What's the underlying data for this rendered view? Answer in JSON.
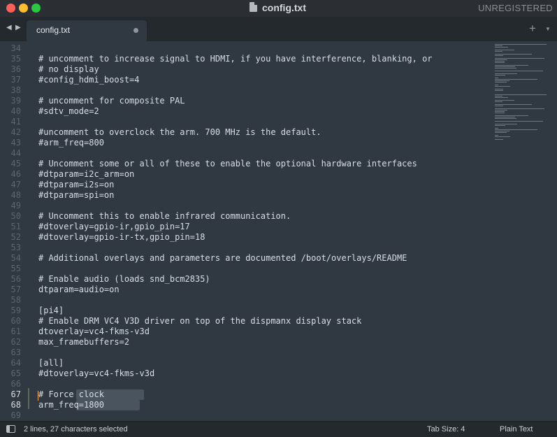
{
  "window": {
    "title": "config.txt",
    "license": "UNREGISTERED"
  },
  "tab": {
    "label": "config.txt"
  },
  "editor": {
    "lines": [
      {
        "n": "34",
        "text": ""
      },
      {
        "n": "35",
        "text": "# uncomment to increase signal to HDMI, if you have interference, blanking, or"
      },
      {
        "n": "36",
        "text": "# no display"
      },
      {
        "n": "37",
        "text": "#config_hdmi_boost=4"
      },
      {
        "n": "38",
        "text": ""
      },
      {
        "n": "39",
        "text": "# uncomment for composite PAL"
      },
      {
        "n": "40",
        "text": "#sdtv_mode=2"
      },
      {
        "n": "41",
        "text": ""
      },
      {
        "n": "42",
        "text": "#uncomment to overclock the arm. 700 MHz is the default."
      },
      {
        "n": "43",
        "text": "#arm_freq=800"
      },
      {
        "n": "44",
        "text": ""
      },
      {
        "n": "45",
        "text": "# Uncomment some or all of these to enable the optional hardware interfaces"
      },
      {
        "n": "46",
        "text": "#dtparam=i2c_arm=on"
      },
      {
        "n": "47",
        "text": "#dtparam=i2s=on"
      },
      {
        "n": "48",
        "text": "#dtparam=spi=on"
      },
      {
        "n": "49",
        "text": ""
      },
      {
        "n": "50",
        "text": "# Uncomment this to enable infrared communication."
      },
      {
        "n": "51",
        "text": "#dtoverlay=gpio-ir,gpio_pin=17"
      },
      {
        "n": "52",
        "text": "#dtoverlay=gpio-ir-tx,gpio_pin=18"
      },
      {
        "n": "53",
        "text": ""
      },
      {
        "n": "54",
        "text": "# Additional overlays and parameters are documented /boot/overlays/README"
      },
      {
        "n": "55",
        "text": ""
      },
      {
        "n": "56",
        "text": "# Enable audio (loads snd_bcm2835)"
      },
      {
        "n": "57",
        "text": "dtparam=audio=on"
      },
      {
        "n": "58",
        "text": ""
      },
      {
        "n": "59",
        "text": "[pi4]"
      },
      {
        "n": "60",
        "text": "# Enable DRM VC4 V3D driver on top of the dispmanx display stack"
      },
      {
        "n": "61",
        "text": "dtoverlay=vc4-fkms-v3d"
      },
      {
        "n": "62",
        "text": "max_framebuffers=2"
      },
      {
        "n": "63",
        "text": ""
      },
      {
        "n": "64",
        "text": "[all]"
      },
      {
        "n": "65",
        "text": "#dtoverlay=vc4-fkms-v3d"
      },
      {
        "n": "66",
        "text": ""
      },
      {
        "n": "67",
        "text": "# Force clock"
      },
      {
        "n": "68",
        "text": "arm_freq=1800"
      },
      {
        "n": "69",
        "text": ""
      }
    ]
  },
  "statusbar": {
    "selection": "2 lines, 27 characters selected",
    "tab_size": "Tab Size: 4",
    "syntax": "Plain Text"
  },
  "icons": {
    "close": "close-icon",
    "minimize": "minimize-icon",
    "maximize": "maximize-icon",
    "document": "document-icon",
    "nav_left": "chevron-left-icon",
    "nav_right": "chevron-right-icon",
    "new_tab": "plus-icon",
    "tab_menu": "chevron-down-icon",
    "panel": "sidebar-toggle-icon"
  },
  "colors": {
    "editor_bg": "#303841",
    "titlebar_bg": "#2b2f33",
    "tabbar_bg": "#24292d",
    "text": "#d8dee9",
    "line_number": "#5c6670",
    "selection": "#4a545f",
    "cursor": "#f9ae58"
  }
}
